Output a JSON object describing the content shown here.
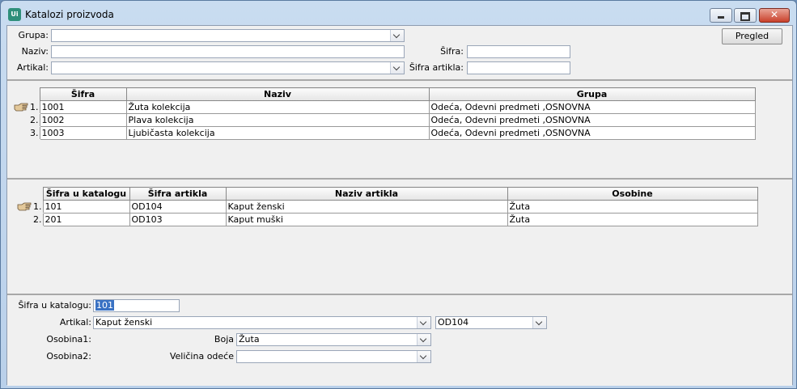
{
  "window": {
    "title": "Katalozi proizvoda",
    "close_glyph": "✕"
  },
  "filters": {
    "grupa_label": "Grupa:",
    "grupa_value": "",
    "naziv_label": "Naziv:",
    "naziv_value": "",
    "artikal_label": "Artikal:",
    "artikal_value": "",
    "sifra_label": "Šifra:",
    "sifra_value": "",
    "sifra_artikla_label": "Šifra artikla:",
    "sifra_artikla_value": "",
    "pregled_label": "Pregled"
  },
  "catalogs": {
    "columns": [
      "Šifra",
      "Naziv",
      "Grupa"
    ],
    "rows": [
      {
        "num": "1.",
        "sifra": "1001",
        "naziv": "Žuta kolekcija",
        "grupa": "Odeća, Odevni predmeti ,OSNOVNA"
      },
      {
        "num": "2.",
        "sifra": "1002",
        "naziv": "Plava kolekcija",
        "grupa": "Odeća, Odevni predmeti ,OSNOVNA"
      },
      {
        "num": "3.",
        "sifra": "1003",
        "naziv": "Ljubičasta kolekcija",
        "grupa": "Odeća, Odevni predmeti ,OSNOVNA"
      }
    ]
  },
  "items": {
    "columns": [
      "Šifra u katalogu",
      "Šifra artikla",
      "Naziv artikla",
      "Osobine"
    ],
    "rows": [
      {
        "num": "1.",
        "sifra_katalog": "101",
        "sifra_artikla": "OD104",
        "naziv_artikla": "Kaput ženski",
        "osobine": "Žuta"
      },
      {
        "num": "2.",
        "sifra_katalog": "201",
        "sifra_artikla": "OD103",
        "naziv_artikla": "Kaput muški",
        "osobine": "Žuta"
      }
    ]
  },
  "detail": {
    "sifra_katalog_label": "Šifra u katalogu:",
    "sifra_katalog_value": "101",
    "artikal_label": "Artikal:",
    "artikal_value": "Kaput ženski",
    "artikal_code": "OD104",
    "osobina1_label": "Osobina1:",
    "osobina1_name": "Boja",
    "osobina1_value": "Žuta",
    "osobina2_label": "Osobina2:",
    "osobina2_name": "Veličina odeće",
    "osobina2_value": ""
  },
  "colors": {
    "selection": "#3a72c4",
    "close_button": "#c9402b"
  }
}
